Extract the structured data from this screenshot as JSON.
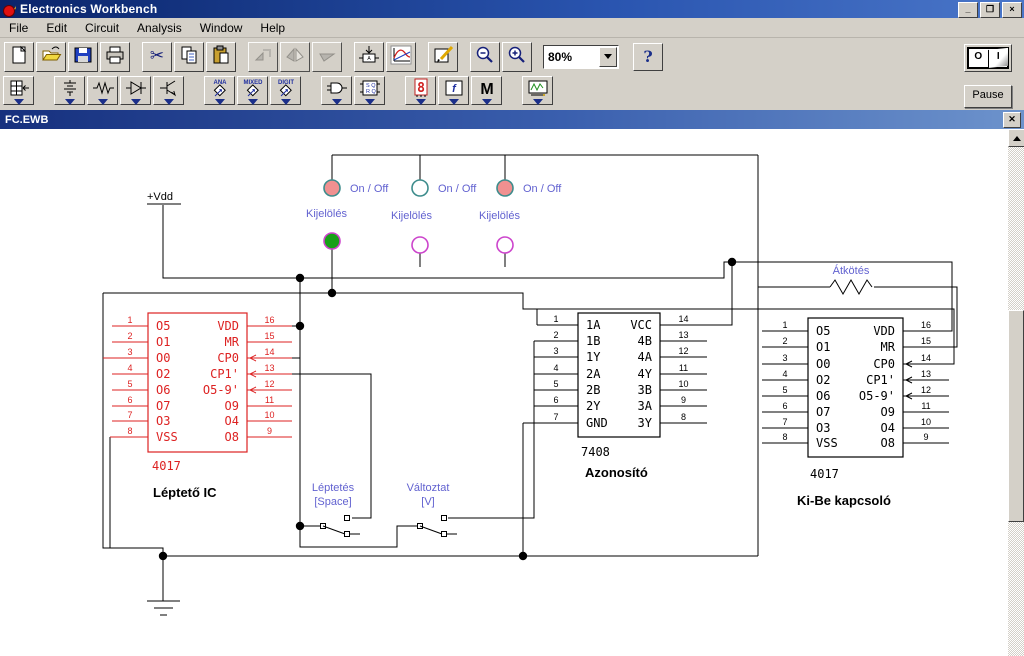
{
  "window": {
    "title": "Electronics Workbench",
    "minimize": "_",
    "restore": "❐",
    "close": "×"
  },
  "menu": [
    "File",
    "Edit",
    "Circuit",
    "Analysis",
    "Window",
    "Help"
  ],
  "toolbar_main": [
    {
      "name": "new",
      "icon": "new"
    },
    {
      "name": "open",
      "icon": "open"
    },
    {
      "name": "save",
      "icon": "save"
    },
    {
      "name": "print",
      "icon": "print"
    },
    {
      "name": "cut",
      "icon": "cut"
    },
    {
      "name": "copy",
      "icon": "copy"
    },
    {
      "name": "paste",
      "icon": "paste"
    },
    {
      "name": "rotate",
      "icon": "rotate",
      "disabled": true
    },
    {
      "name": "flip-horizontal",
      "icon": "fliph",
      "disabled": true
    },
    {
      "name": "flip-vertical",
      "icon": "flipv",
      "disabled": true
    },
    {
      "name": "zoom-to-fit",
      "icon": "zoomfit"
    },
    {
      "name": "display-graphs",
      "icon": "graph"
    },
    {
      "name": "component-properties",
      "icon": "props"
    },
    {
      "name": "zoom-out",
      "icon": "zoomout"
    },
    {
      "name": "zoom-in",
      "icon": "zoomin"
    }
  ],
  "zoom_control": {
    "value": "80%"
  },
  "help_button": "?",
  "power_switch": {
    "off": "O",
    "on": "I"
  },
  "pause_button": "Pause",
  "document": {
    "title": "FC.EWB"
  },
  "parts_toolbar": [
    {
      "name": "favorites",
      "icon": "fav",
      "text": ""
    },
    {
      "name": "sources",
      "icon": "sources",
      "text": ""
    },
    {
      "name": "basic",
      "icon": "basic",
      "text": ""
    },
    {
      "name": "diodes",
      "icon": "diodes",
      "text": ""
    },
    {
      "name": "transistors",
      "icon": "transistors",
      "text": ""
    },
    {
      "name": "analog-ics",
      "icon": "diamond",
      "text": "ANA"
    },
    {
      "name": "mixed-ics",
      "icon": "diamond",
      "text": "MIXED"
    },
    {
      "name": "digital-ics",
      "icon": "diamond",
      "text": "DIGIT"
    },
    {
      "name": "logic-gates",
      "icon": "gates",
      "text": ""
    },
    {
      "name": "digital",
      "icon": "flipflop",
      "text": "SQRQ"
    },
    {
      "name": "indicators",
      "icon": "sevenseg",
      "text": "8"
    },
    {
      "name": "controls",
      "icon": "controls",
      "text": "f"
    },
    {
      "name": "miscellaneous",
      "icon": "misc",
      "text": "M"
    },
    {
      "name": "instruments",
      "icon": "scope",
      "text": ""
    }
  ],
  "circuit": {
    "power_label": "+Vdd",
    "onoff_lamps": [
      {
        "label": "On / Off",
        "state": "on"
      },
      {
        "label": "On / Off",
        "state": "off"
      },
      {
        "label": "On / Off",
        "state": "on"
      }
    ],
    "select_lamps": [
      {
        "label": "Kijelölés",
        "state": "on"
      },
      {
        "label": "Kijelölés",
        "state": "off"
      },
      {
        "label": "Kijelölés",
        "state": "off"
      }
    ],
    "switches": [
      {
        "label": "Léptetés",
        "key": "[Space]"
      },
      {
        "label": "Változtat",
        "key": "[V]"
      }
    ],
    "jumper_label": "Átkötés",
    "ics": [
      {
        "part": "4017",
        "caption": "Léptető IC",
        "color": "#dd2222",
        "left_pins": [
          {
            "num": "1",
            "label": "O5"
          },
          {
            "num": "2",
            "label": "O1"
          },
          {
            "num": "3",
            "label": "O0"
          },
          {
            "num": "4",
            "label": "O2"
          },
          {
            "num": "5",
            "label": "O6"
          },
          {
            "num": "6",
            "label": "O7"
          },
          {
            "num": "7",
            "label": "O3"
          },
          {
            "num": "8",
            "label": "VSS"
          }
        ],
        "right_pins": [
          {
            "num": "16",
            "label": "VDD"
          },
          {
            "num": "15",
            "label": "MR"
          },
          {
            "num": "14",
            "label": "CP0"
          },
          {
            "num": "13",
            "label": "CP1'"
          },
          {
            "num": "12",
            "label": "O5-9'"
          },
          {
            "num": "11",
            "label": "O9"
          },
          {
            "num": "10",
            "label": "O4"
          },
          {
            "num": "9",
            "label": "O8"
          }
        ]
      },
      {
        "part": "7408",
        "caption": "Azonosító",
        "color": "#000000",
        "left_pins": [
          {
            "num": "1",
            "label": "1A"
          },
          {
            "num": "2",
            "label": "1B"
          },
          {
            "num": "3",
            "label": "1Y"
          },
          {
            "num": "4",
            "label": "2A"
          },
          {
            "num": "5",
            "label": "2B"
          },
          {
            "num": "6",
            "label": "2Y"
          },
          {
            "num": "7",
            "label": "GND"
          }
        ],
        "right_pins": [
          {
            "num": "14",
            "label": "VCC"
          },
          {
            "num": "13",
            "label": "4B"
          },
          {
            "num": "12",
            "label": "4A"
          },
          {
            "num": "11",
            "label": "4Y"
          },
          {
            "num": "10",
            "label": "3B"
          },
          {
            "num": "9",
            "label": "3A"
          },
          {
            "num": "8",
            "label": "3Y"
          }
        ]
      },
      {
        "part": "4017",
        "caption": "Ki-Be kapcsoló",
        "color": "#000000",
        "left_pins": [
          {
            "num": "1",
            "label": "O5"
          },
          {
            "num": "2",
            "label": "O1"
          },
          {
            "num": "3",
            "label": "O0"
          },
          {
            "num": "4",
            "label": "O2"
          },
          {
            "num": "5",
            "label": "O6"
          },
          {
            "num": "6",
            "label": "O7"
          },
          {
            "num": "7",
            "label": "O3"
          },
          {
            "num": "8",
            "label": "VSS"
          }
        ],
        "right_pins": [
          {
            "num": "16",
            "label": "VDD"
          },
          {
            "num": "15",
            "label": "MR"
          },
          {
            "num": "14",
            "label": "CP0"
          },
          {
            "num": "13",
            "label": "CP1'"
          },
          {
            "num": "12",
            "label": "O5-9'"
          },
          {
            "num": "11",
            "label": "O9"
          },
          {
            "num": "10",
            "label": "O4"
          },
          {
            "num": "9",
            "label": "O8"
          }
        ]
      }
    ],
    "colors": {
      "wire": "#000000",
      "label": "#6262d0",
      "lamp_on": "#f09090",
      "lamp_ring": "#3d8c8c",
      "select_on": "#18a018",
      "select_ring": "#cc44cc"
    }
  }
}
